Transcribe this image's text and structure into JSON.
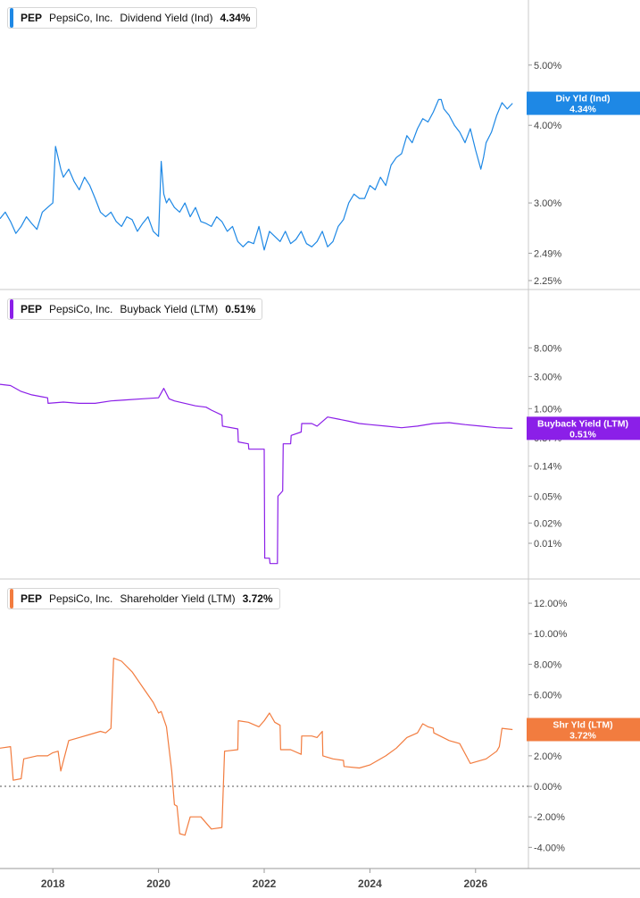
{
  "chart_data": [
    {
      "type": "line",
      "ticker": "PEP",
      "company": "PepsiCo, Inc.",
      "metric": "Dividend Yield (Ind)",
      "current_value": "4.34%",
      "badge_label": "Div Yld (Ind)",
      "color": "#1e88e5",
      "y_scale": "log",
      "ylim": [
        2.25,
        5.8
      ],
      "y_ticks": [
        {
          "v": 5.0,
          "label": "5.00%"
        },
        {
          "v": 4.0,
          "label": "4.00%"
        },
        {
          "v": 3.0,
          "label": "3.00%"
        },
        {
          "v": 2.49,
          "label": "2.49%"
        },
        {
          "v": 2.25,
          "label": "2.25%"
        }
      ],
      "x": [
        2017.0,
        2017.1,
        2017.2,
        2017.3,
        2017.4,
        2017.5,
        2017.6,
        2017.7,
        2017.8,
        2017.9,
        2018.0,
        2018.05,
        2018.1,
        2018.15,
        2018.2,
        2018.3,
        2018.4,
        2018.5,
        2018.6,
        2018.7,
        2018.8,
        2018.9,
        2019.0,
        2019.1,
        2019.2,
        2019.3,
        2019.4,
        2019.5,
        2019.6,
        2019.7,
        2019.8,
        2019.9,
        2020.0,
        2020.05,
        2020.1,
        2020.15,
        2020.2,
        2020.3,
        2020.4,
        2020.5,
        2020.6,
        2020.7,
        2020.8,
        2020.9,
        2021.0,
        2021.1,
        2021.2,
        2021.3,
        2021.4,
        2021.5,
        2021.6,
        2021.7,
        2021.8,
        2021.9,
        2022.0,
        2022.1,
        2022.2,
        2022.3,
        2022.4,
        2022.5,
        2022.6,
        2022.7,
        2022.8,
        2022.9,
        2023.0,
        2023.1,
        2023.2,
        2023.3,
        2023.4,
        2023.5,
        2023.6,
        2023.7,
        2023.8,
        2023.9,
        2024.0,
        2024.1,
        2024.2,
        2024.3,
        2024.4,
        2024.5,
        2024.6,
        2024.7,
        2024.8,
        2024.9,
        2025.0,
        2025.1,
        2025.2,
        2025.3,
        2025.35,
        2025.4,
        2025.5,
        2025.6,
        2025.7,
        2025.8,
        2025.9,
        2026.0,
        2026.1,
        2026.15,
        2026.2,
        2026.3,
        2026.4,
        2026.5,
        2026.6,
        2026.7
      ],
      "values": [
        2.83,
        2.9,
        2.8,
        2.68,
        2.75,
        2.85,
        2.78,
        2.72,
        2.9,
        2.95,
        3.0,
        3.7,
        3.55,
        3.4,
        3.3,
        3.4,
        3.25,
        3.15,
        3.3,
        3.2,
        3.05,
        2.9,
        2.85,
        2.9,
        2.8,
        2.75,
        2.85,
        2.82,
        2.7,
        2.78,
        2.85,
        2.7,
        2.65,
        3.5,
        3.1,
        3.0,
        3.05,
        2.95,
        2.9,
        3.0,
        2.85,
        2.95,
        2.8,
        2.78,
        2.75,
        2.85,
        2.8,
        2.7,
        2.75,
        2.6,
        2.55,
        2.6,
        2.58,
        2.75,
        2.52,
        2.7,
        2.65,
        2.6,
        2.7,
        2.58,
        2.62,
        2.7,
        2.58,
        2.55,
        2.6,
        2.7,
        2.55,
        2.6,
        2.75,
        2.82,
        3.0,
        3.1,
        3.05,
        3.05,
        3.2,
        3.15,
        3.3,
        3.2,
        3.45,
        3.55,
        3.6,
        3.85,
        3.75,
        3.95,
        4.1,
        4.05,
        4.2,
        4.4,
        4.4,
        4.25,
        4.15,
        4.0,
        3.9,
        3.75,
        3.95,
        3.65,
        3.4,
        3.55,
        3.75,
        3.9,
        4.15,
        4.35,
        4.25,
        4.34
      ]
    },
    {
      "type": "line",
      "ticker": "PEP",
      "company": "PepsiCo, Inc.",
      "metric": "Buyback Yield (LTM)",
      "current_value": "0.51%",
      "badge_label": "Buyback Yield (LTM)",
      "color": "#8b1fe8",
      "y_scale": "log",
      "ylim": [
        0.004,
        25
      ],
      "y_ticks": [
        {
          "v": 8.0,
          "label": "8.00%"
        },
        {
          "v": 3.0,
          "label": "3.00%"
        },
        {
          "v": 1.0,
          "label": "1.00%"
        },
        {
          "v": 0.37,
          "label": "0.37%"
        },
        {
          "v": 0.14,
          "label": "0.14%"
        },
        {
          "v": 0.05,
          "label": "0.05%"
        },
        {
          "v": 0.02,
          "label": "0.02%"
        },
        {
          "v": 0.01,
          "label": "0.01%"
        }
      ],
      "x": [
        2017.0,
        2017.2,
        2017.4,
        2017.6,
        2017.8,
        2017.9,
        2017.91,
        2018.2,
        2018.5,
        2018.8,
        2019.1,
        2019.4,
        2019.7,
        2020.0,
        2020.1,
        2020.2,
        2020.3,
        2020.5,
        2020.7,
        2020.9,
        2021.0,
        2021.2,
        2021.21,
        2021.5,
        2021.51,
        2021.7,
        2021.71,
        2021.9,
        2022.0,
        2022.01,
        2022.1,
        2022.11,
        2022.25,
        2022.26,
        2022.35,
        2022.36,
        2022.5,
        2022.51,
        2022.7,
        2022.71,
        2022.9,
        2023.0,
        2023.2,
        2023.4,
        2023.6,
        2023.8,
        2024.0,
        2024.3,
        2024.6,
        2024.9,
        2025.2,
        2025.5,
        2025.8,
        2026.1,
        2026.4,
        2026.7
      ],
      "values": [
        2.3,
        2.2,
        1.8,
        1.6,
        1.5,
        1.45,
        1.2,
        1.25,
        1.2,
        1.2,
        1.3,
        1.35,
        1.4,
        1.45,
        2.0,
        1.4,
        1.3,
        1.2,
        1.1,
        1.05,
        0.95,
        0.8,
        0.55,
        0.5,
        0.32,
        0.3,
        0.25,
        0.25,
        0.25,
        0.006,
        0.006,
        0.005,
        0.005,
        0.05,
        0.06,
        0.3,
        0.3,
        0.4,
        0.45,
        0.6,
        0.6,
        0.55,
        0.75,
        0.7,
        0.65,
        0.6,
        0.58,
        0.55,
        0.52,
        0.55,
        0.6,
        0.62,
        0.58,
        0.55,
        0.52,
        0.51
      ]
    },
    {
      "type": "line",
      "ticker": "PEP",
      "company": "PepsiCo, Inc.",
      "metric": "Shareholder Yield (LTM)",
      "current_value": "3.72%",
      "badge_label": "Shr Yld (LTM)",
      "color": "#f27c3f",
      "y_scale": "linear",
      "ylim": [
        -4.8,
        13
      ],
      "y_ticks": [
        {
          "v": 12,
          "label": "12.00%"
        },
        {
          "v": 10,
          "label": "10.00%"
        },
        {
          "v": 8,
          "label": "8.00%"
        },
        {
          "v": 6,
          "label": "6.00%"
        },
        {
          "v": 4,
          "label": "4.00%"
        },
        {
          "v": 2,
          "label": "2.00%"
        },
        {
          "v": 0,
          "label": "0.00%"
        },
        {
          "v": -2,
          "label": "-2.00%"
        },
        {
          "v": -4,
          "label": "-4.00%"
        }
      ],
      "zero_line": true,
      "x": [
        2017.0,
        2017.2,
        2017.25,
        2017.4,
        2017.45,
        2017.7,
        2017.9,
        2018.0,
        2018.1,
        2018.15,
        2018.3,
        2018.5,
        2018.7,
        2018.9,
        2019.0,
        2019.1,
        2019.15,
        2019.3,
        2019.5,
        2019.7,
        2019.9,
        2020.0,
        2020.05,
        2020.15,
        2020.25,
        2020.3,
        2020.35,
        2020.4,
        2020.5,
        2020.6,
        2020.8,
        2021.0,
        2021.2,
        2021.25,
        2021.5,
        2021.51,
        2021.7,
        2021.9,
        2022.0,
        2022.1,
        2022.2,
        2022.3,
        2022.31,
        2022.5,
        2022.7,
        2022.71,
        2022.9,
        2023.0,
        2023.1,
        2023.11,
        2023.3,
        2023.5,
        2023.51,
        2023.8,
        2024.0,
        2024.3,
        2024.5,
        2024.7,
        2024.9,
        2025.0,
        2025.1,
        2025.2,
        2025.21,
        2025.5,
        2025.7,
        2025.9,
        2026.0,
        2026.2,
        2026.4,
        2026.45,
        2026.5,
        2026.7
      ],
      "values": [
        2.5,
        2.6,
        0.4,
        0.5,
        1.8,
        2.0,
        2.0,
        2.2,
        2.3,
        1.0,
        3.0,
        3.2,
        3.4,
        3.6,
        3.5,
        3.8,
        8.4,
        8.2,
        7.5,
        6.5,
        5.5,
        4.8,
        4.9,
        3.9,
        1.0,
        -1.2,
        -1.3,
        -3.1,
        -3.2,
        -2.0,
        -2.0,
        -2.8,
        -2.7,
        2.3,
        2.4,
        4.3,
        4.2,
        3.9,
        4.3,
        4.8,
        4.2,
        4.0,
        2.4,
        2.4,
        2.1,
        3.3,
        3.3,
        3.2,
        3.6,
        2.0,
        1.8,
        1.7,
        1.3,
        1.2,
        1.4,
        2.0,
        2.5,
        3.2,
        3.5,
        4.1,
        3.9,
        3.8,
        3.5,
        3.0,
        2.8,
        1.5,
        1.6,
        1.8,
        2.3,
        2.6,
        3.8,
        3.72
      ]
    }
  ],
  "x_axis": {
    "range": [
      2017.0,
      2027.0
    ],
    "ticks": [
      {
        "v": 2018,
        "label": "2018"
      },
      {
        "v": 2020,
        "label": "2020"
      },
      {
        "v": 2022,
        "label": "2022"
      },
      {
        "v": 2024,
        "label": "2024"
      },
      {
        "v": 2026,
        "label": "2026"
      }
    ]
  }
}
